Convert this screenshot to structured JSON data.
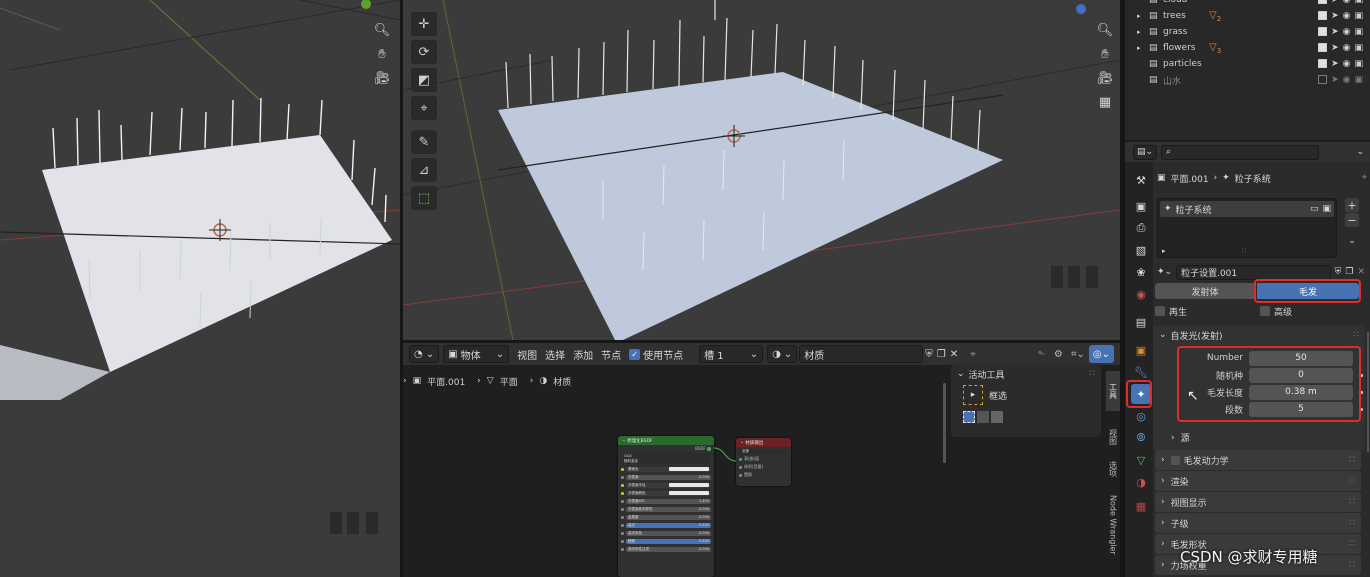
{
  "left_viewport": {},
  "main_viewport": {},
  "outliner": {
    "rows": [
      {
        "name": "cloud",
        "indent": 3,
        "badge": ""
      },
      {
        "name": "trees",
        "indent": 1,
        "badge": "2"
      },
      {
        "name": "grass",
        "indent": 1,
        "badge": ""
      },
      {
        "name": "flowers",
        "indent": 1,
        "badge": "3"
      },
      {
        "name": "particles",
        "indent": 2,
        "badge": ""
      },
      {
        "name": "山水",
        "indent": 2,
        "badge": ""
      }
    ]
  },
  "node_editor": {
    "header": {
      "object_mode": "物体",
      "menu_view": "视图",
      "menu_select": "选择",
      "menu_add": "添加",
      "menu_node": "节点",
      "use_nodes_label": "使用节点",
      "slot": "槽 1",
      "material_name": "材质"
    },
    "breadcrumb": {
      "object": "平面.001",
      "mesh": "平面",
      "material": "材质"
    },
    "sidebar": {
      "active_tool_title": "活动工具",
      "tool_name": "框选",
      "tabs": [
        "工具",
        "视图",
        "选项",
        "Node Wrangler"
      ]
    },
    "bsdf_node": {
      "title": "原理化BSDF",
      "output": "BSDF",
      "dist": "GGX",
      "sss": "随机游走",
      "rows": [
        "基础色",
        "次表面",
        "次表面半径",
        "次表面颜色",
        "次表面IOR",
        "次表面各向异性",
        "金属度",
        "高光",
        "高光染色",
        "糙度",
        "各向异性过滤"
      ],
      "values": [
        "",
        "0.000",
        "",
        "",
        "1.400",
        "0.000",
        "0.000",
        "0.500",
        "0.000",
        "0.500",
        "0.000"
      ]
    },
    "output_node": {
      "title": "材质输出",
      "target": "全部",
      "rows": [
        "表(曲)面",
        "体积(音量)",
        "置换"
      ]
    }
  },
  "properties": {
    "breadcrumb_object": "平面.001",
    "breadcrumb_system": "粒子系统",
    "particle_system_item": "粒子系统",
    "settings_name": "粒子设置.001",
    "type_buttons": [
      "发射体",
      "毛发"
    ],
    "checkbox_regrow": "再生",
    "checkbox_advanced": "高级",
    "emission_panel_title": "自发光(发射)",
    "fields": [
      {
        "label": "Number",
        "value": "50"
      },
      {
        "label": "随机种",
        "value": "0"
      },
      {
        "label": "毛发长度",
        "value": "0.38 m"
      },
      {
        "label": "段数",
        "value": "5"
      }
    ],
    "source_label": "源",
    "panels": [
      "毛发动力学",
      "渲染",
      "视图显示",
      "子级",
      "毛发形状",
      "力场权重"
    ]
  },
  "watermark": "CSDN @求财专用糖",
  "colors": {
    "accent_blue": "#4772b3",
    "highlight_red": "#e02c2c",
    "plane_blue": "#bfc9dc",
    "node_green": "#2a6a2f",
    "node_red": "#6b2226"
  }
}
